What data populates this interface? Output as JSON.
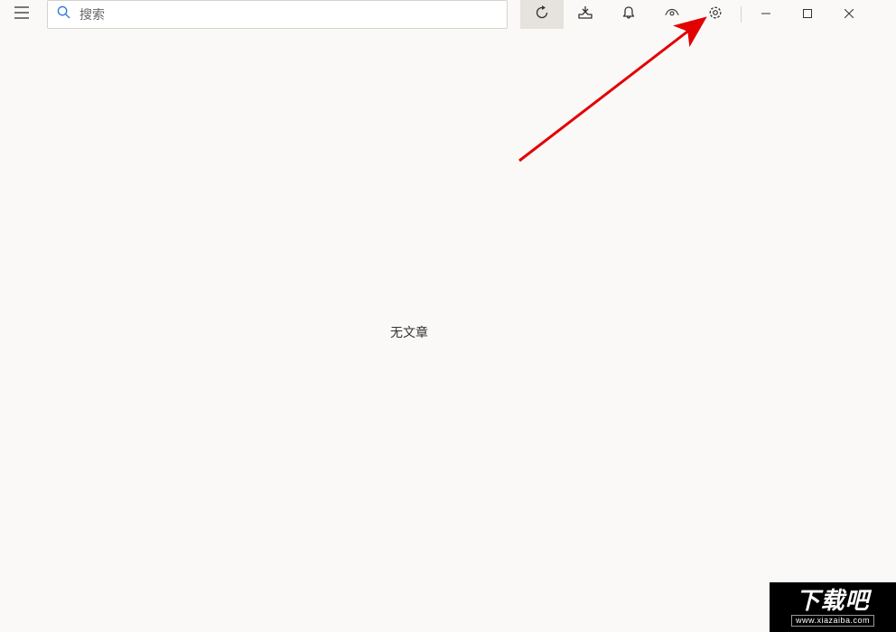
{
  "search": {
    "placeholder": "搜索"
  },
  "content": {
    "empty": "无文章"
  },
  "watermark": {
    "brand": "下载吧",
    "url": "www.xiazaiba.com"
  },
  "toolbar": {
    "menu": "menu",
    "refresh": "refresh",
    "inbox": "inbox",
    "notifications": "notifications",
    "view": "view",
    "settings": "settings"
  },
  "window": {
    "minimize": "minimize",
    "maximize": "maximize",
    "close": "close"
  }
}
